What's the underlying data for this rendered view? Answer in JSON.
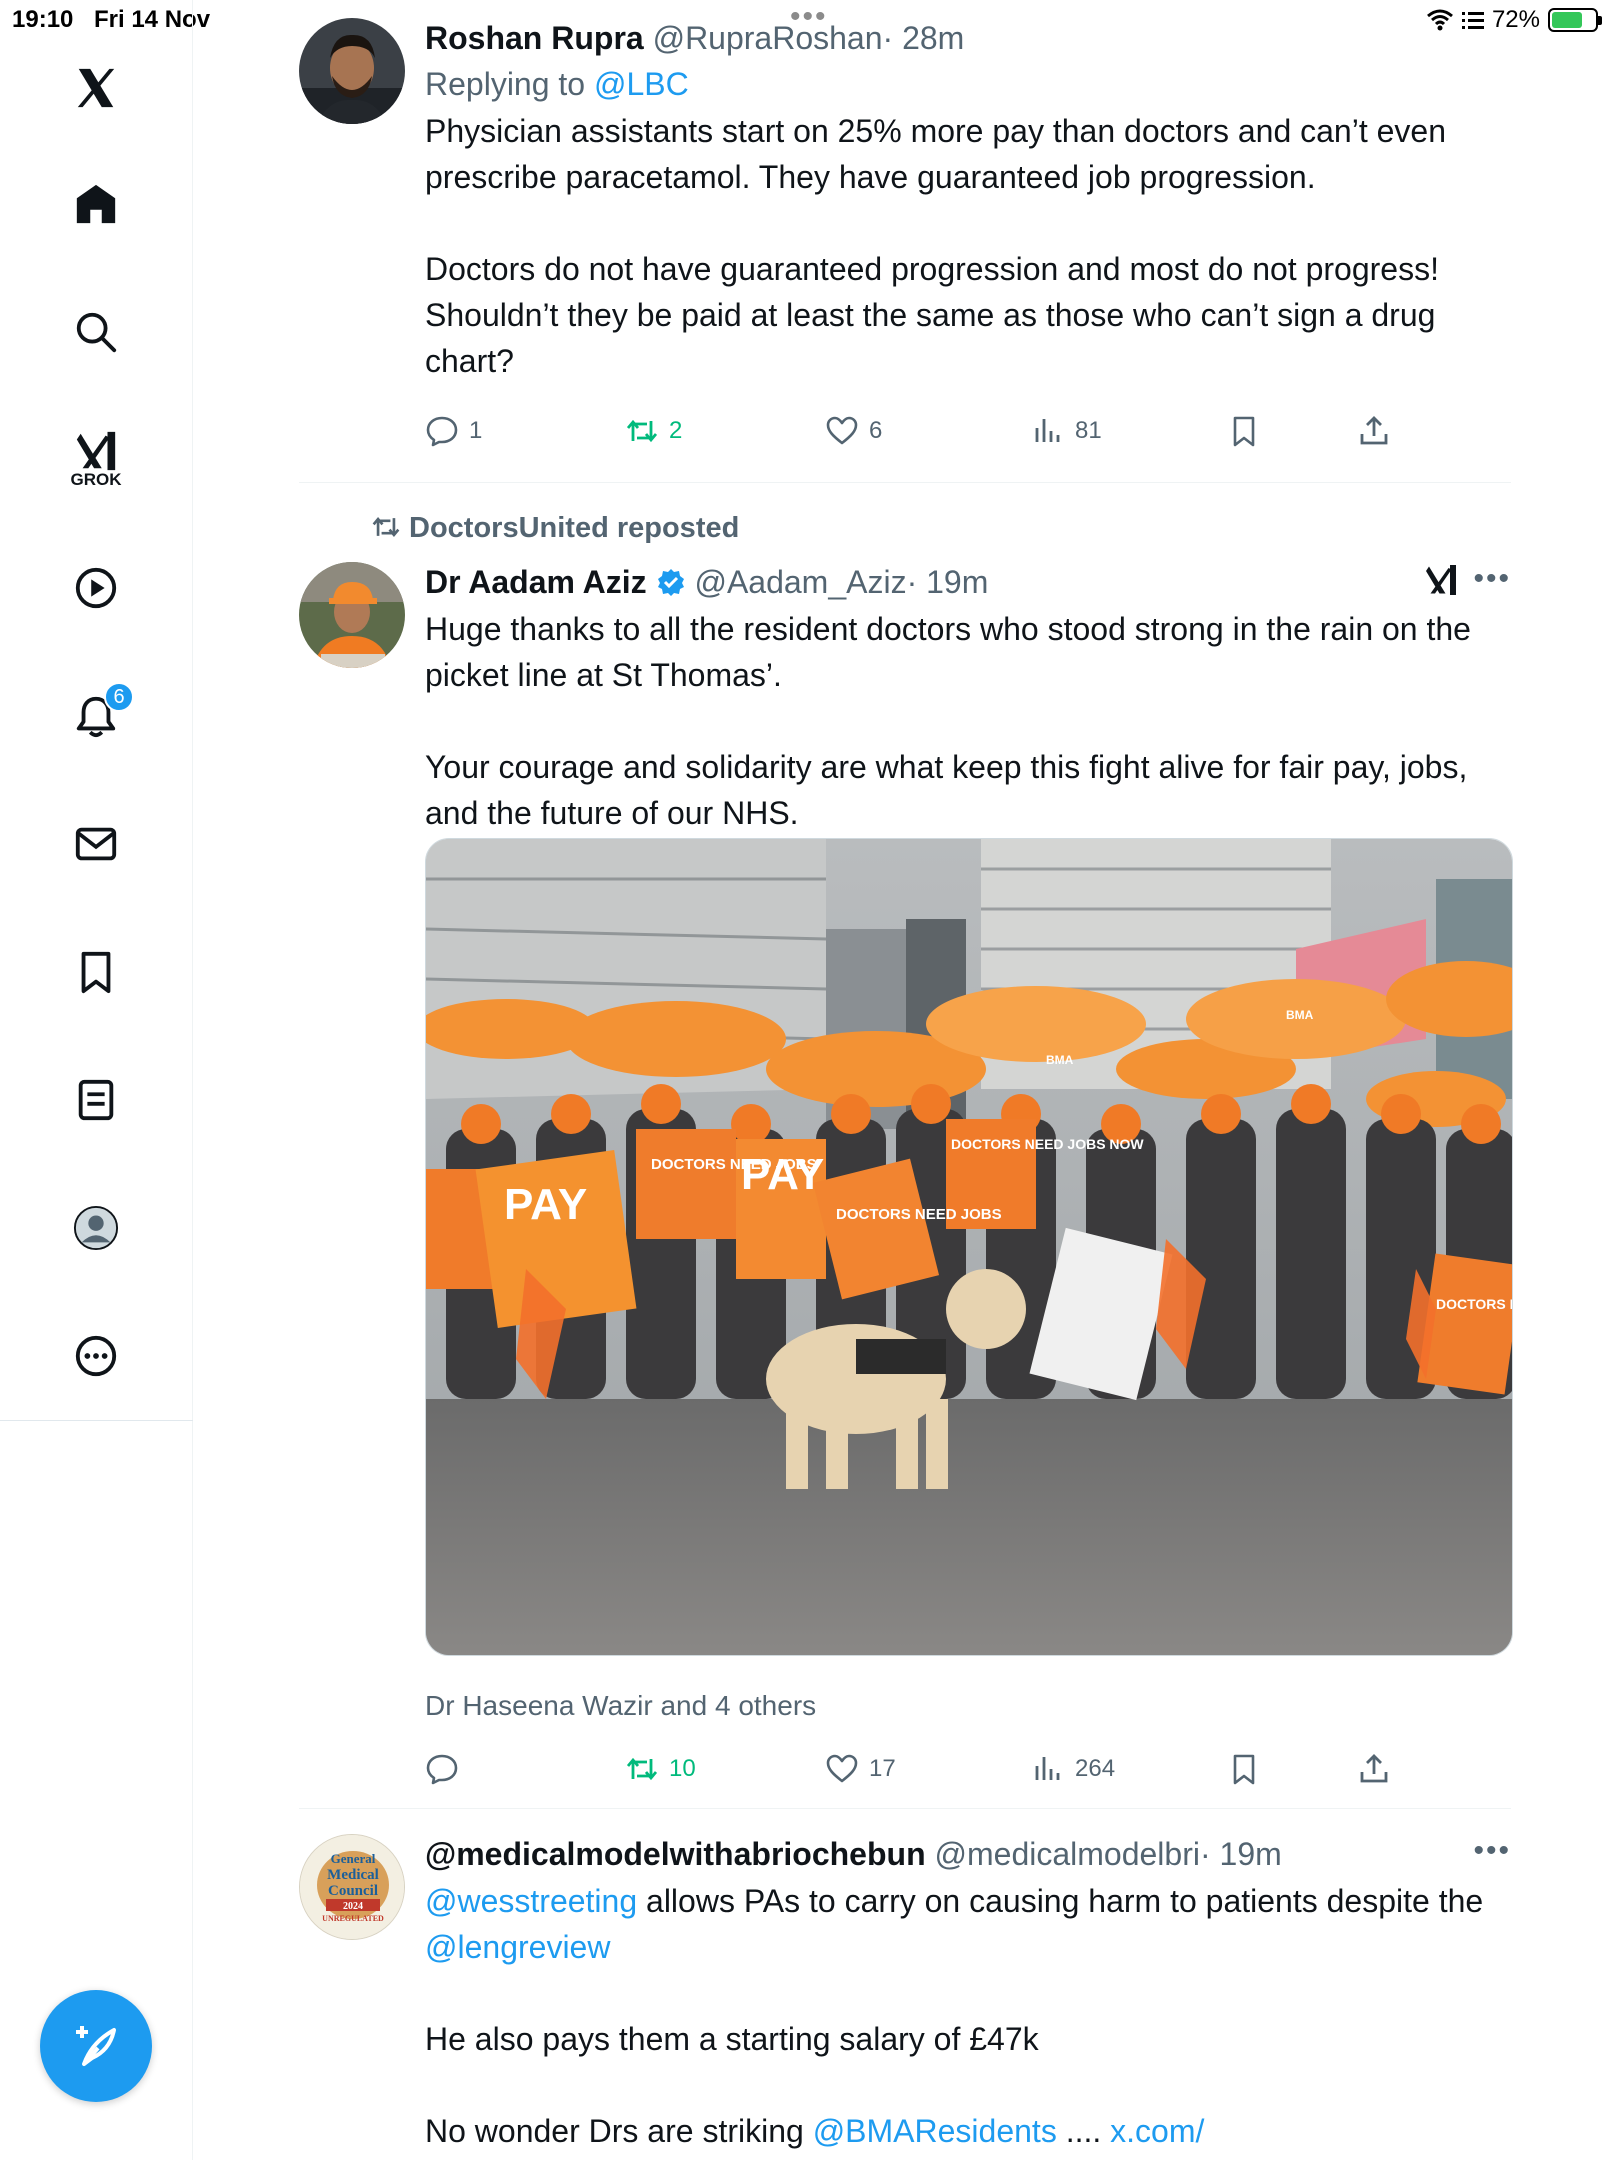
{
  "status_bar": {
    "time": "19:10",
    "date": "Fri 14 Nov",
    "battery": "72%",
    "battery_fraction": 0.72
  },
  "sidebar": {
    "items": [
      {
        "icon": "x-logo-icon"
      },
      {
        "icon": "home-icon"
      },
      {
        "icon": "search-icon"
      },
      {
        "icon": "grok-icon",
        "label": "GROK"
      },
      {
        "icon": "video-icon"
      },
      {
        "icon": "notifications-icon",
        "badge": "6"
      },
      {
        "icon": "messages-icon"
      },
      {
        "icon": "bookmarks-icon"
      },
      {
        "icon": "lists-icon"
      },
      {
        "icon": "profile-icon"
      },
      {
        "icon": "more-icon"
      }
    ],
    "compose_icon": "compose-icon"
  },
  "tweets": [
    {
      "name": "Roshan Rupra",
      "handle": "@RupraRoshan",
      "time": "· 28m",
      "replying_prefix": "Replying to",
      "replying_to": "@LBC",
      "body": [
        "Physician assistants start on 25% more pay than doctors and can’t even prescribe paracetamol. They have guaranteed job progression.",
        "Doctors do not have guaranteed progression and most do not progress! Shouldn’t they be paid at least the same as those who can’t sign a drug chart?"
      ],
      "actions": {
        "replies": "1",
        "reposts": "2",
        "likes": "6",
        "views": "81"
      }
    },
    {
      "repost_by": "DoctorsUnited reposted",
      "name": "Dr Aadam Aziz",
      "verified": true,
      "handle": "@Aadam_Aziz",
      "time": "· 19m",
      "body": [
        "Huge thanks to all the resident doctors who stood strong in the rain on the picket line at St Thomas’.",
        "Your courage and solidarity are what keep this fight alive for fair pay, jobs, and the future of our NHS."
      ],
      "photo_signs": [
        "PAY",
        "DOCTORS NEED JOBS",
        "DOCTORS NEED JOBS NOW",
        "BMA"
      ],
      "tagged": "Dr Haseena Wazir and 4 others",
      "actions": {
        "replies": "",
        "reposts": "10",
        "likes": "17",
        "views": "264"
      }
    },
    {
      "name": "@medicalmodelwithabriochebun",
      "handle": "@medicalmodelbri",
      "time": "· 19m",
      "avatar_text": [
        "General",
        "Medical",
        "Council",
        "2024",
        "UNREGULATED"
      ],
      "body_line1_mention": "@wesstreeting",
      "body_line1_text": " allows PAs to carry on causing harm to patients despite the ",
      "body_line1_mention2": "@lengreview",
      "body_line2": "He also pays them a starting salary of £47k",
      "body_line3_text": "No wonder Drs are striking ",
      "body_line3_mention": "@BMAResidents",
      "body_line3_tail": " .... ",
      "body_line3_link": "x.com/"
    }
  ],
  "colors": {
    "accent": "#1d9bf0",
    "repost_green": "#00ba7c",
    "muted": "#536471",
    "text": "#0f1419"
  }
}
